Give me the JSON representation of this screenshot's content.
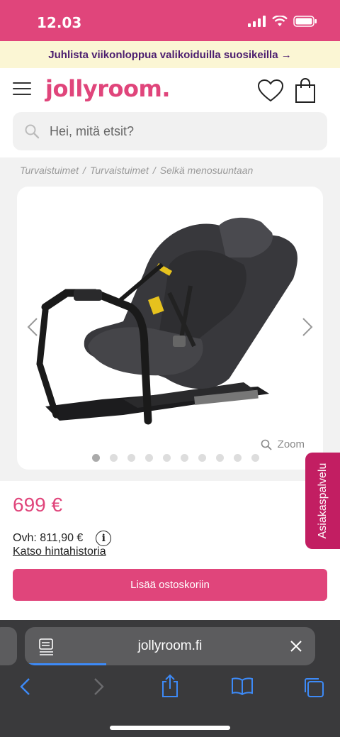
{
  "status": {
    "time": "12.03"
  },
  "promo": {
    "text": "Juhlista viikonloppua valikoiduilla suosikeilla →"
  },
  "header": {
    "logo": "jollyroom."
  },
  "search": {
    "placeholder": "Hei, mitä etsit?"
  },
  "breadcrumb": [
    "Turvaistuimet",
    "Turvaistuimet",
    "Selkä menosuuntaan"
  ],
  "gallery": {
    "zoom_label": "Zoom",
    "image_count": 10,
    "active_index": 0
  },
  "side_tab": {
    "label": "Asiakaspalvelu"
  },
  "product": {
    "price": "699 €",
    "ovh": "Ovh: 811,90 €",
    "history_link": "Katso hintahistoria",
    "add_to_cart": "Lisää ostoskoriin"
  },
  "browser": {
    "url": "jollyroom.fi",
    "load_progress": 0.28
  },
  "colors": {
    "brand": "#e0457b",
    "promo_bg": "#fbf6d4",
    "side_tab": "#c21e62"
  }
}
